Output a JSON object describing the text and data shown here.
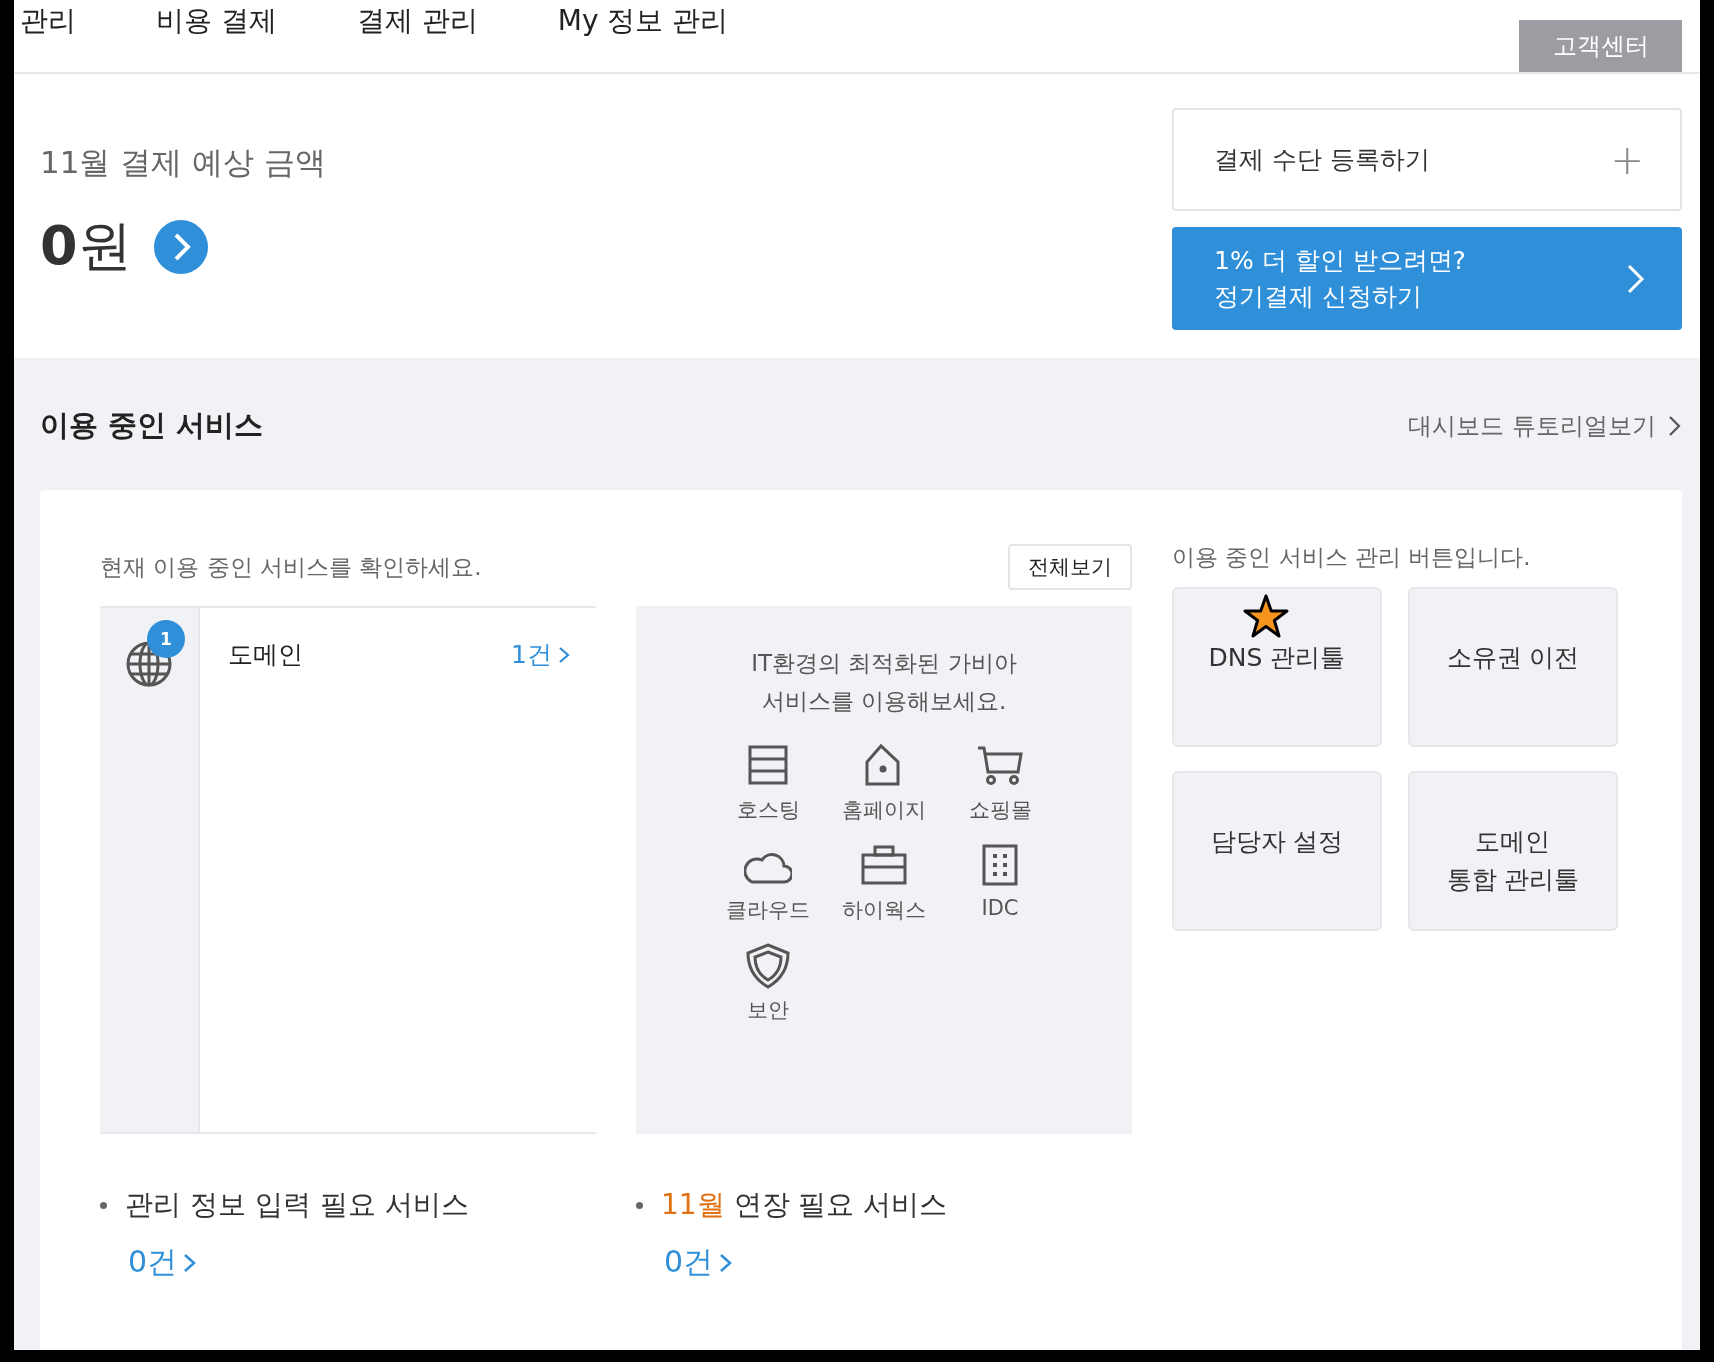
{
  "top_nav": {
    "items": [
      {
        "label": "관리"
      },
      {
        "label": "비용 결제"
      },
      {
        "label": "결제 관리"
      },
      {
        "label": "My 정보 관리"
      }
    ],
    "support_button": "고객센터"
  },
  "billing": {
    "title": "11월 결제 예상 금액",
    "amount_number": "0",
    "amount_unit": "원",
    "register_payment": "결제 수단 등록하기",
    "register_icon": "+",
    "promo_line_1": "1% 더 할인 받으려면?",
    "promo_line_2": "정기결제 신청하기"
  },
  "services": {
    "title": "이용 중인 서비스",
    "tutorial_link": "대시보드 튜토리얼보기",
    "intro": "현재 이용 중인 서비스를 확인하세요.",
    "view_all": "전체보기",
    "in_use": [
      {
        "name": "도메인",
        "badge": "1",
        "count": "1건"
      }
    ],
    "promo_text": "IT환경의 최적화된 가비아\n서비스를 이용해보세요.",
    "catalog": [
      {
        "kind": "server",
        "label": "호스팅"
      },
      {
        "kind": "house",
        "label": "홈페이지"
      },
      {
        "kind": "cart",
        "label": "쇼핑몰"
      },
      {
        "kind": "cloud",
        "label": "클라우드"
      },
      {
        "kind": "case",
        "label": "하이웍스"
      },
      {
        "kind": "building",
        "label": "IDC"
      },
      {
        "kind": "shield",
        "label": "보안"
      }
    ],
    "manage_intro": "이용 중인 서비스 관리 버튼입니다.",
    "manage_buttons": [
      {
        "label": "DNS 관리툴",
        "starred": true
      },
      {
        "label": "소유권 이전",
        "starred": false
      },
      {
        "label": "담당자 설정",
        "starred": false
      },
      {
        "label": "도메인\n통합 관리툴",
        "starred": false
      }
    ],
    "notices": [
      {
        "text": "관리 정보 입력 필요 서비스",
        "count": "0건"
      },
      {
        "highlight": "11월",
        "text": "연장 필요 서비스",
        "count": "0건"
      }
    ]
  }
}
